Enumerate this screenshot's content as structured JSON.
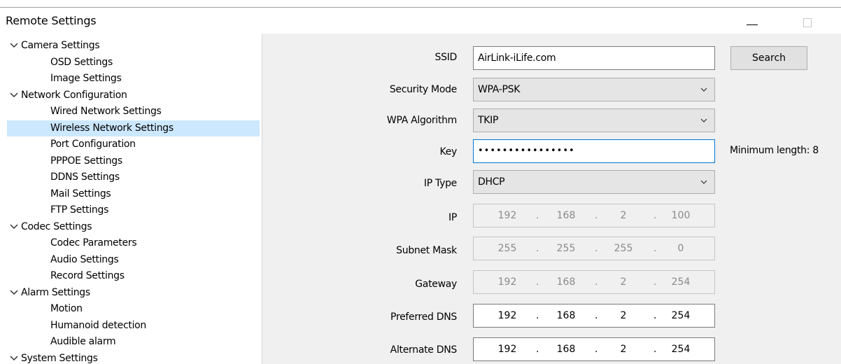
{
  "window": {
    "title": "Remote Settings"
  },
  "tree": [
    {
      "label": "Camera Settings",
      "type": "group"
    },
    {
      "label": "OSD Settings",
      "type": "child"
    },
    {
      "label": "Image Settings",
      "type": "child"
    },
    {
      "label": "Network Configuration",
      "type": "group"
    },
    {
      "label": "Wired Network Settings",
      "type": "child"
    },
    {
      "label": "Wireless Network Settings",
      "type": "child",
      "selected": true
    },
    {
      "label": "Port Configuration",
      "type": "child"
    },
    {
      "label": "PPPOE Settings",
      "type": "child"
    },
    {
      "label": "DDNS Settings",
      "type": "child"
    },
    {
      "label": "Mail Settings",
      "type": "child"
    },
    {
      "label": "FTP Settings",
      "type": "child"
    },
    {
      "label": "Codec Settings",
      "type": "group"
    },
    {
      "label": "Codec Parameters",
      "type": "child"
    },
    {
      "label": "Audio Settings",
      "type": "child"
    },
    {
      "label": "Record Settings",
      "type": "child"
    },
    {
      "label": "Alarm Settings",
      "type": "group"
    },
    {
      "label": "Motion",
      "type": "child"
    },
    {
      "label": "Humanoid detection",
      "type": "child"
    },
    {
      "label": "Audible alarm",
      "type": "child"
    },
    {
      "label": "System Settings",
      "type": "group"
    }
  ],
  "form": {
    "ssid": {
      "label": "SSID",
      "value": "AirLink-iLife.com"
    },
    "search_button": "Search",
    "security_mode": {
      "label": "Security Mode",
      "value": "WPA-PSK"
    },
    "wpa_algorithm": {
      "label": "WPA Algorithm",
      "value": "TKIP"
    },
    "key": {
      "label": "Key",
      "value": "••••••••••••••••",
      "hint": "Minimum length: 8"
    },
    "ip_type": {
      "label": "IP Type",
      "value": "DHCP"
    },
    "ip": {
      "label": "IP",
      "octets": [
        "192",
        "168",
        "2",
        "100"
      ],
      "enabled": false
    },
    "subnet_mask": {
      "label": "Subnet Mask",
      "octets": [
        "255",
        "255",
        "255",
        "0"
      ],
      "enabled": false
    },
    "gateway": {
      "label": "Gateway",
      "octets": [
        "192",
        "168",
        "2",
        "254"
      ],
      "enabled": false
    },
    "preferred_dns": {
      "label": "Preferred DNS",
      "octets": [
        "192",
        "168",
        "2",
        "254"
      ],
      "enabled": true
    },
    "alternate_dns": {
      "label": "Alternate DNS",
      "octets": [
        "192",
        "168",
        "2",
        "254"
      ],
      "enabled": true
    },
    "ip_separator": "."
  },
  "colors": {
    "selection": "#cce8ff",
    "panel_bg": "#f0f0f0",
    "disabled_text": "#8a8a8a"
  }
}
